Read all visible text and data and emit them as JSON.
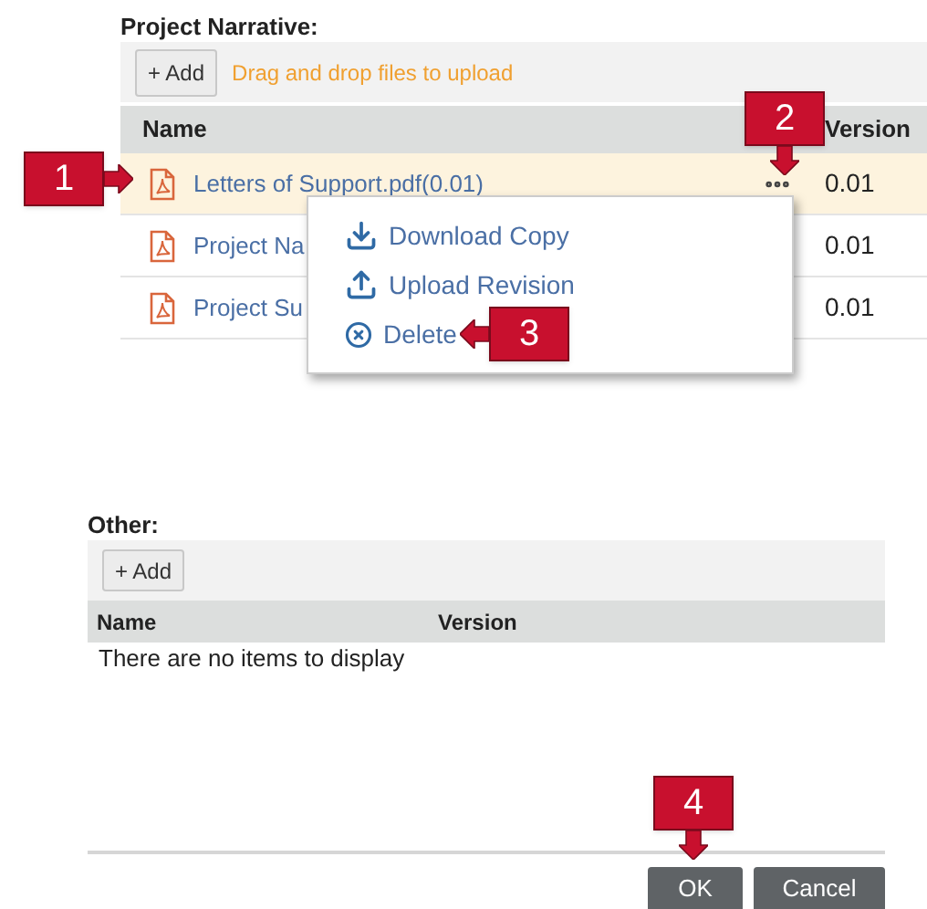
{
  "narrative": {
    "title": "Project Narrative:",
    "add_button": "+ Add",
    "drop_hint": "Drag and drop files to upload",
    "columns": [
      "Name",
      "Version"
    ],
    "rows": [
      {
        "name": "Letters of Support.pdf(0.01)",
        "version": "0.01",
        "selected": true
      },
      {
        "name": "Project Na",
        "version": "0.01",
        "selected": false
      },
      {
        "name": "Project Su",
        "version": "0.01",
        "selected": false
      }
    ]
  },
  "menu": {
    "items": [
      {
        "kind": "download",
        "label": "Download Copy"
      },
      {
        "kind": "upload",
        "label": "Upload Revision"
      },
      {
        "kind": "delete",
        "label": "Delete"
      }
    ]
  },
  "other": {
    "title": "Other:",
    "add_button": "+ Add",
    "columns": [
      "Name",
      "Version"
    ],
    "empty": "There are no items to display"
  },
  "buttons": [
    "OK",
    "Cancel"
  ],
  "callouts": [
    {
      "label": "1",
      "kind": "right"
    },
    {
      "label": "2",
      "kind": "down"
    },
    {
      "label": "3",
      "kind": "left"
    },
    {
      "label": "4",
      "kind": "down"
    }
  ]
}
